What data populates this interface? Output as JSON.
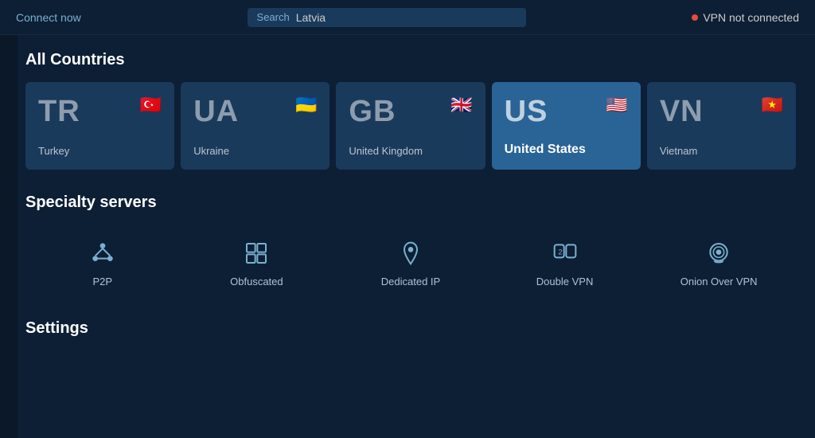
{
  "header": {
    "connect_label": "Connect now",
    "search_label": "Search",
    "search_value": "Latvia",
    "vpn_status": "VPN not connected"
  },
  "all_countries": {
    "title": "All Countries",
    "countries": [
      {
        "code": "TR",
        "name": "Turkey",
        "flag": "🇹🇷"
      },
      {
        "code": "UA",
        "name": "Ukraine",
        "flag": "🇺🇦"
      },
      {
        "code": "GB",
        "name": "United Kingdom",
        "flag": "🇬🇧"
      },
      {
        "code": "US",
        "name": "United States",
        "flag": "🇺🇸",
        "highlighted": true
      },
      {
        "code": "VN",
        "name": "Vietnam",
        "flag": "🇻🇳"
      }
    ]
  },
  "specialty": {
    "title": "Specialty servers",
    "items": [
      {
        "id": "p2p",
        "label": "P2P"
      },
      {
        "id": "obfuscated",
        "label": "Obfuscated"
      },
      {
        "id": "dedicated-ip",
        "label": "Dedicated IP"
      },
      {
        "id": "double-vpn",
        "label": "Double VPN"
      },
      {
        "id": "onion-over-vpn",
        "label": "Onion Over VPN"
      }
    ]
  },
  "settings": {
    "title": "Settings"
  }
}
